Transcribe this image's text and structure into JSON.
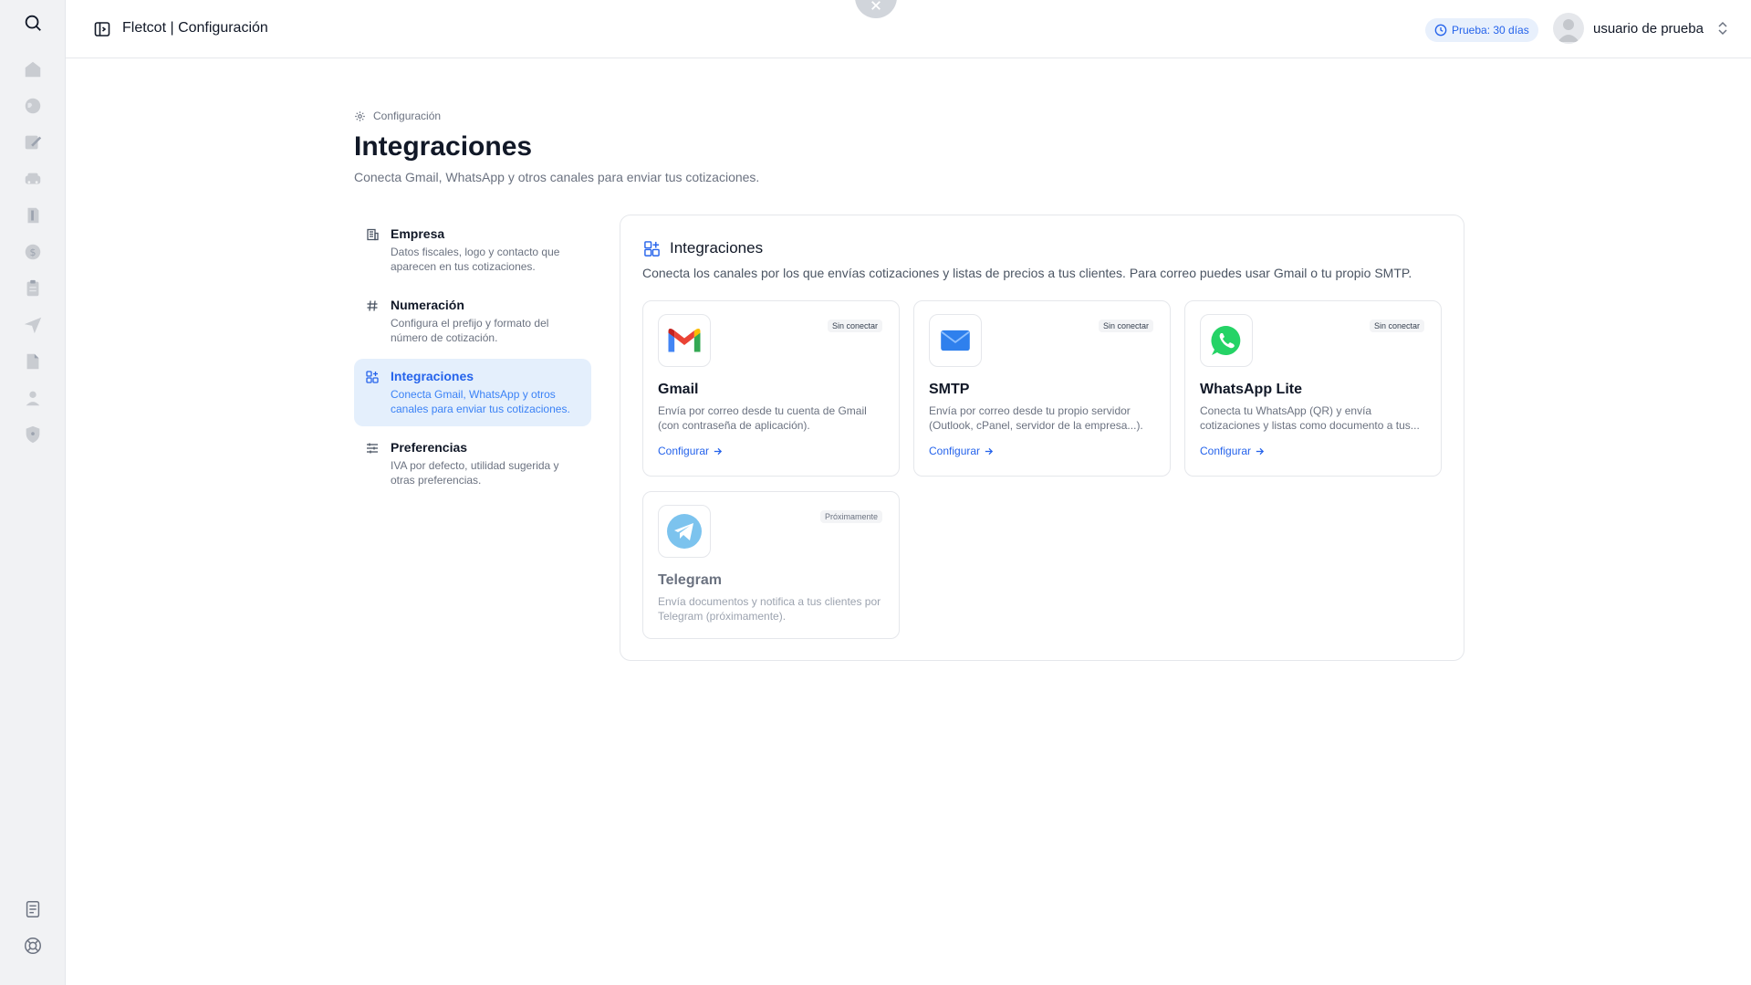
{
  "app": {
    "title": "Fletcot | Configuración",
    "trial_badge": "Prueba: 30 días",
    "user_name": "usuario de prueba"
  },
  "rail": {
    "icons": [
      "search-icon",
      "home-icon",
      "globe-icon",
      "edit-icon",
      "car-icon",
      "document-icon",
      "dollar-icon",
      "clipboard-icon",
      "send-icon",
      "file-icon",
      "user-icon",
      "shield-icon",
      "notes-icon",
      "help-icon"
    ]
  },
  "page": {
    "breadcrumb": "Configuración",
    "title": "Integraciones",
    "subtitle": "Conecta Gmail, WhatsApp y otros canales para enviar tus cotizaciones."
  },
  "settings_nav": [
    {
      "label": "Empresa",
      "desc": "Datos fiscales, logo y contacto que aparecen en tus cotizaciones.",
      "icon": "building-icon"
    },
    {
      "label": "Numeración",
      "desc": "Configura el prefijo y formato del número de cotización.",
      "icon": "hash-icon"
    },
    {
      "label": "Integraciones",
      "desc": "Conecta Gmail, WhatsApp y otros canales para enviar tus cotizaciones.",
      "icon": "grid-plus-icon",
      "active": true
    },
    {
      "label": "Preferencias",
      "desc": "IVA por defecto, utilidad sugerida y otras preferencias.",
      "icon": "sliders-icon"
    }
  ],
  "panel": {
    "title": "Integraciones",
    "subtitle": "Conecta los canales por los que envías cotizaciones y listas de precios a tus clientes. Para correo puedes usar Gmail o tu propio SMTP."
  },
  "integrations": [
    {
      "name": "Gmail",
      "badge": "Sin conectar",
      "desc": "Envía por correo desde tu cuenta de Gmail (con contraseña de aplicación).",
      "action": "Configurar"
    },
    {
      "name": "SMTP",
      "badge": "Sin conectar",
      "desc": "Envía por correo desde tu propio servidor (Outlook, cPanel, servidor de la empresa...).",
      "action": "Configurar"
    },
    {
      "name": "WhatsApp Lite",
      "badge": "Sin conectar",
      "desc": "Conecta tu WhatsApp (QR) y envía cotizaciones y listas como documento a tus...",
      "action": "Configurar"
    },
    {
      "name": "Telegram",
      "badge": "Próximamente",
      "desc": "Envía documentos y notifica a tus clientes por Telegram (próximamente)."
    }
  ],
  "colors": {
    "accent": "#2563eb",
    "active_bg": "#e4effc",
    "rail_bg": "#f1f2f4",
    "gmail_red": "#ea4335",
    "whatsapp_green": "#25d366",
    "telegram_blue": "#2aabee"
  }
}
